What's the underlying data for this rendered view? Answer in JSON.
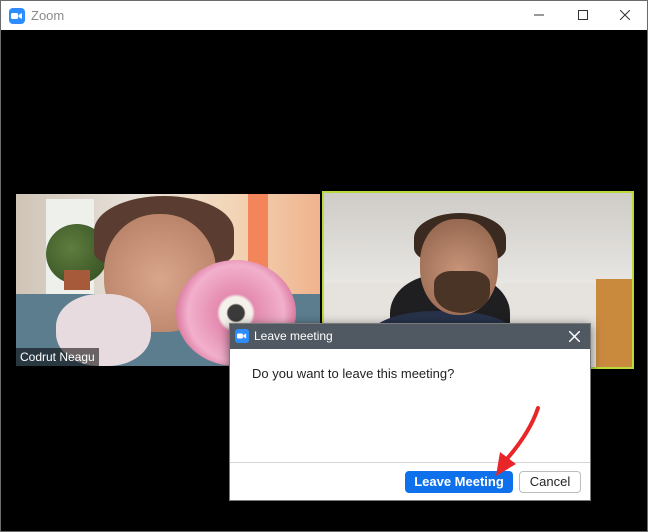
{
  "window": {
    "title": "Zoom",
    "controls": [
      "minimize-icon",
      "maximize-icon",
      "close-icon"
    ]
  },
  "participants": [
    {
      "name": "Codrut Neagu"
    },
    {
      "name": "",
      "active_speaker": true,
      "highlight_color": "#b9dc3c"
    }
  ],
  "dialog": {
    "title": "Leave meeting",
    "message": "Do you want to leave this meeting?",
    "primary_button": "Leave Meeting",
    "secondary_button": "Cancel"
  },
  "colors": {
    "accent": "#0e71eb",
    "zoom_logo": "#2d8cff",
    "dialog_titlebar": "#505862",
    "annotation_arrow": "#e8262a"
  }
}
